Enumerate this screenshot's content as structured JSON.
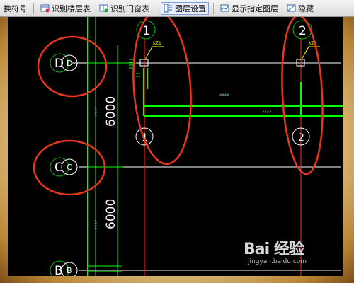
{
  "toolbar": {
    "items": [
      {
        "label": "换符号",
        "icon": "convert-icon"
      },
      {
        "label": "识别楼层表",
        "icon": "identify-floor-icon"
      },
      {
        "label": "识别门窗表",
        "icon": "identify-door-icon"
      },
      {
        "label": "图层设置",
        "icon": "layer-settings-icon"
      },
      {
        "label": "显示指定图层",
        "icon": "show-layer-icon"
      },
      {
        "label": "隐藏",
        "icon": "hide-icon"
      }
    ]
  },
  "drawing": {
    "axis_labels": {
      "top_1": "1",
      "top_2": "2",
      "mid_1": "1",
      "mid_2": "2",
      "row_d_outer": "D",
      "row_d_inner": "D",
      "row_c_outer": "C",
      "row_c_inner": "C",
      "row_b_outer": "B",
      "row_b_inner": "B"
    },
    "dimensions": {
      "upper": "6000",
      "lower": "6000"
    },
    "column_tags": {
      "col_1": "KZ1",
      "col_2": "KZ1"
    },
    "beam_tags": {
      "beam_a": "####",
      "beam_b": "####"
    },
    "side_tags": {
      "upper": "####",
      "lower": "####"
    },
    "colors": {
      "grid": "#ffffff",
      "beam": "#00ff00",
      "axis_red": "#ff2a2a",
      "annotation": "#e8371f",
      "tag": "#ffff00"
    }
  },
  "watermark": {
    "logo": "Bai 经验",
    "sub": "jingyan.baidu.com"
  }
}
